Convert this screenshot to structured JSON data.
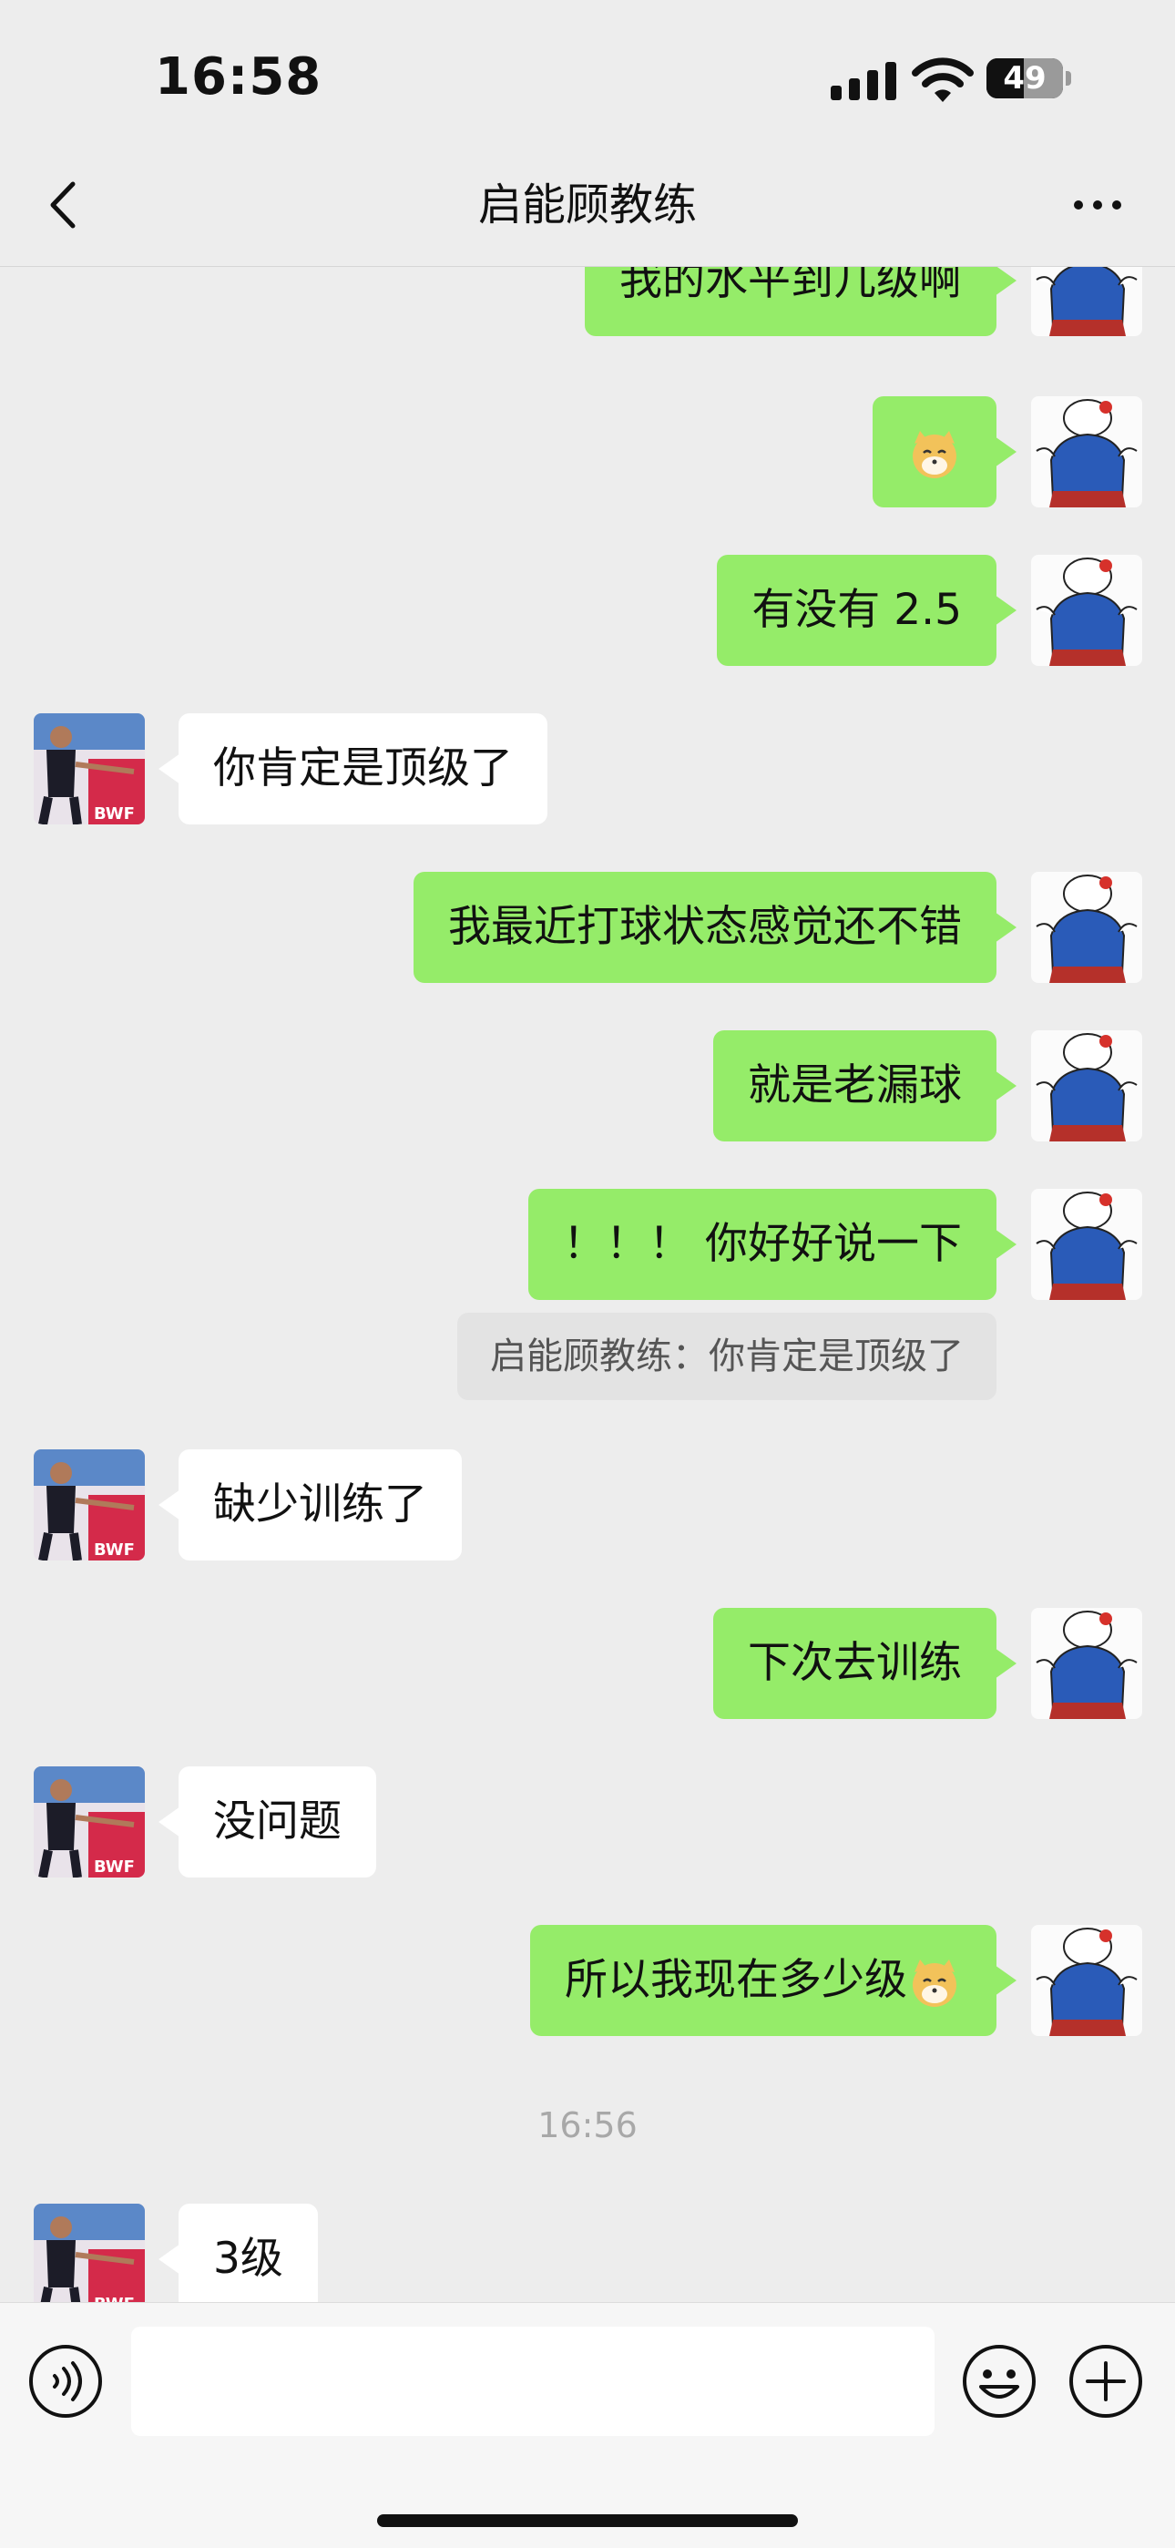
{
  "status_bar": {
    "time": "16:58",
    "battery": "49",
    "battery_level": 0.49
  },
  "nav": {
    "title": "启能顾教练"
  },
  "messages": [
    {
      "text": "我的水平到几级啊"
    },
    {
      "text": ""
    },
    {
      "text": "有没有 2.5"
    },
    {
      "text": "你肯定是顶级了"
    },
    {
      "text": "我最近打球状态感觉还不错"
    },
    {
      "text": "就是老漏球"
    },
    {
      "text": "！！！ 你好好说一下"
    },
    {
      "text": "缺少训练了"
    },
    {
      "text": "下次去训练"
    },
    {
      "text": "没问题"
    },
    {
      "text": "所以我现在多少级"
    },
    {
      "text": "3级"
    }
  ],
  "quote": {
    "text": "启能顾教练：你肯定是顶级了"
  },
  "timestamp": "16:56",
  "input": {
    "value": "",
    "placeholder": ""
  },
  "colors": {
    "green_bubble": "#95ec69",
    "background": "#ededed",
    "white_bubble": "#ffffff"
  }
}
